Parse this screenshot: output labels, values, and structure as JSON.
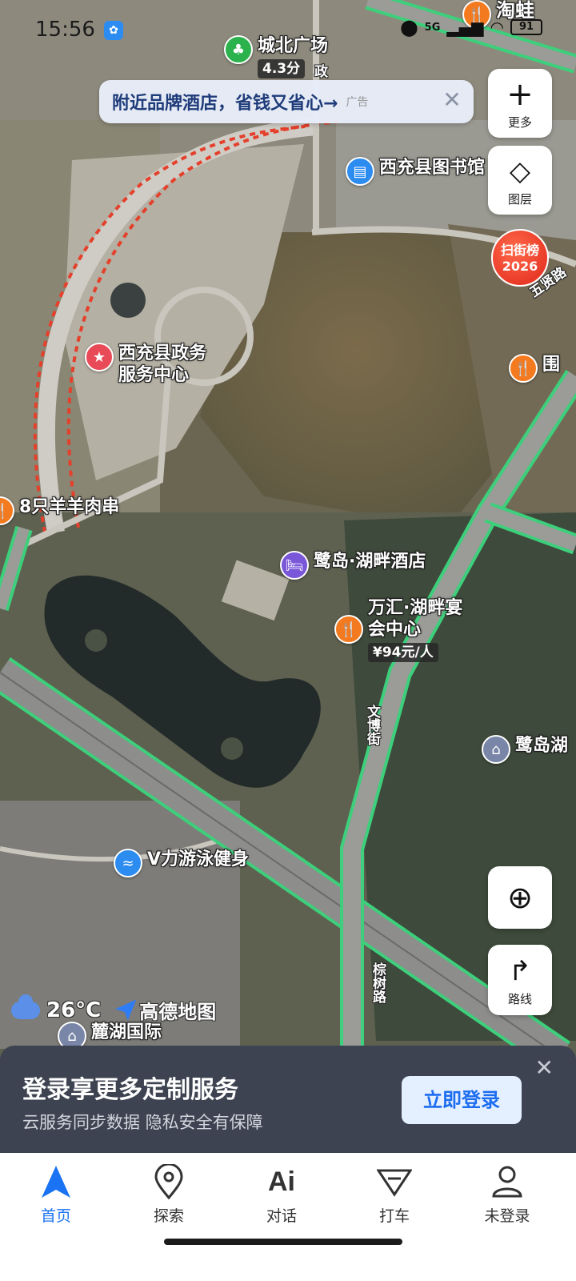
{
  "status_bar": {
    "time": "15:56",
    "network": "5G",
    "battery": "91"
  },
  "ad_banner": {
    "text": "附近品牌酒店，省钱又省心→",
    "tag": "广告"
  },
  "map_controls": {
    "more_label": "更多",
    "layers_label": "图层",
    "hot_badge_line1": "扫街榜",
    "hot_badge_line2": "2026",
    "route_label": "路线"
  },
  "pois": [
    {
      "name": "城北广场",
      "rating": "4.3分",
      "icon": "park-icon",
      "color": "#2bb24c"
    },
    {
      "name": "淘蛙",
      "icon": "restaurant-icon",
      "color": "#f47a1f"
    },
    {
      "name": "西充县图书馆",
      "icon": "library-icon",
      "color": "#2d8cf0"
    },
    {
      "name_line1": "西充县政务",
      "name_line2": "服务中心",
      "icon": "star-icon",
      "color": "#e84a57"
    },
    {
      "name": "8只羊羊肉串",
      "icon": "restaurant-icon",
      "color": "#f47a1f"
    },
    {
      "name": "鹭岛·湖畔酒店",
      "icon": "hotel-icon",
      "color": "#7a56d9"
    },
    {
      "name_line1": "万汇·湖畔宴",
      "name_line2": "会中心",
      "price": "¥94元/人",
      "icon": "restaurant-icon",
      "color": "#f47a1f"
    },
    {
      "name": "鹭岛湖",
      "icon": "building-icon",
      "color": "#7a86a8"
    },
    {
      "name": "V力游泳健身",
      "icon": "swim-icon",
      "color": "#2d8cf0"
    },
    {
      "name": "麓湖国际",
      "icon": "building-icon",
      "color": "#7a86a8"
    },
    {
      "name": "围",
      "icon": "restaurant-icon",
      "color": "#f47a1f"
    }
  ],
  "road_labels": {
    "wenbo": "文博街",
    "zongshu": "棕树路",
    "wuxian": "五贤路",
    "zheng": "政"
  },
  "weather": {
    "temperature": "26°C",
    "brand": "高德地图"
  },
  "login_card": {
    "title": "登录享更多定制服务",
    "subtitle": "云服务同步数据 隐私安全有保障",
    "button": "立即登录"
  },
  "tabs": [
    {
      "label": "首页",
      "icon": "navigate-icon",
      "active": true
    },
    {
      "label": "探索",
      "icon": "location-pin-icon",
      "active": false
    },
    {
      "label": "对话",
      "icon": "ai-icon",
      "active": false
    },
    {
      "label": "打车",
      "icon": "taxi-icon",
      "active": false
    },
    {
      "label": "未登录",
      "icon": "user-icon",
      "active": false
    }
  ]
}
